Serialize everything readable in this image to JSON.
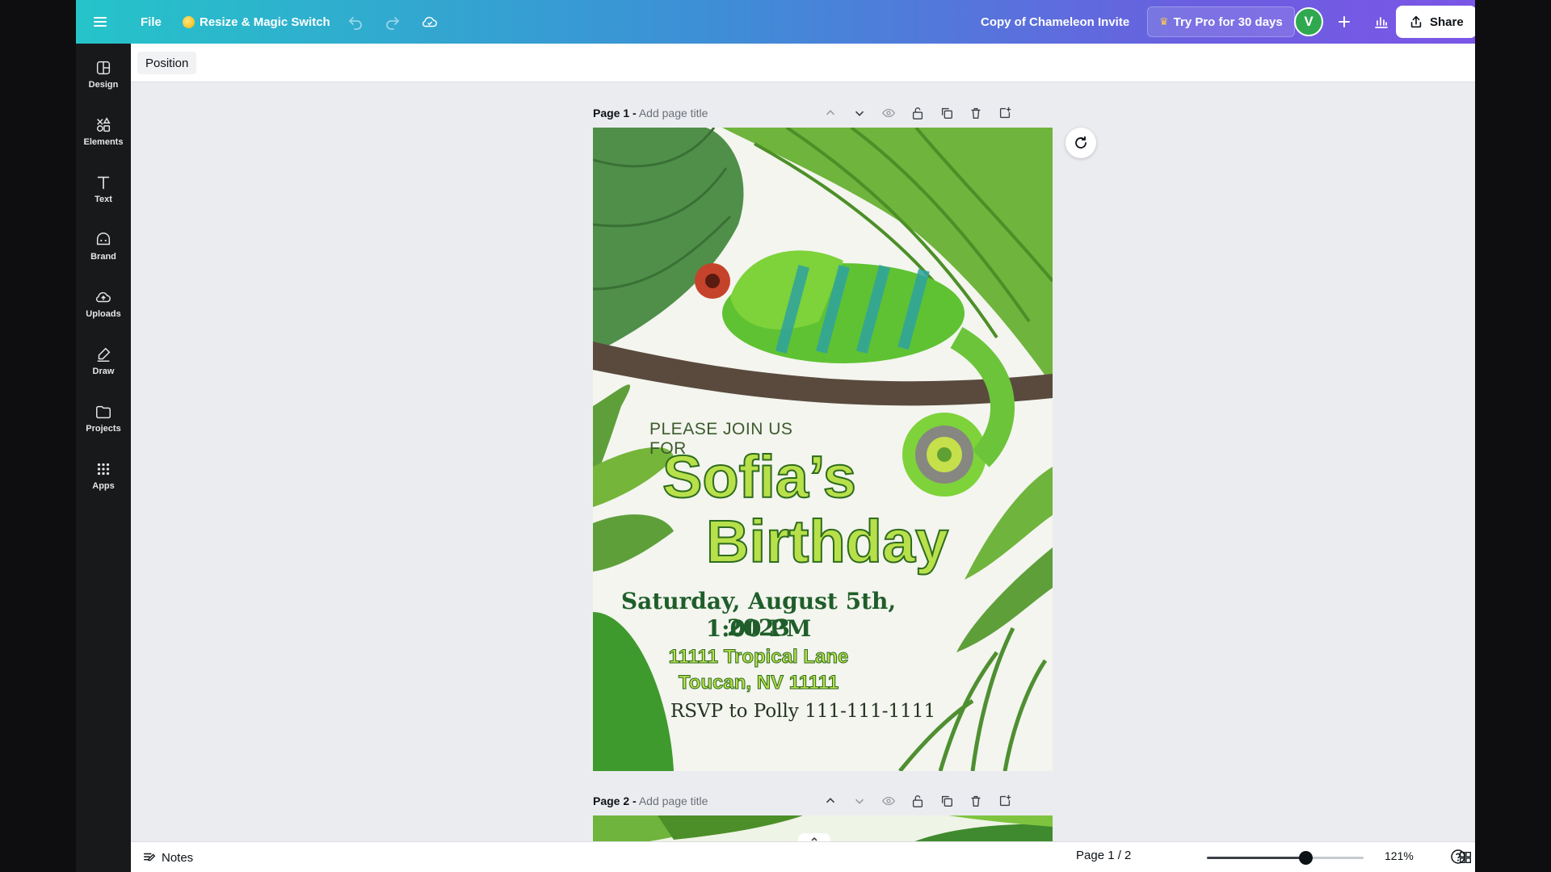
{
  "header": {
    "file_label": "File",
    "magic_label": "Resize & Magic Switch",
    "doc_title": "Copy of Chameleon Invite",
    "pro_label": "Try Pro for 30 days",
    "avatar_initial": "V",
    "share_label": "Share"
  },
  "sidebar": {
    "items": [
      {
        "label": "Design",
        "icon": "layout-icon"
      },
      {
        "label": "Elements",
        "icon": "shapes-icon"
      },
      {
        "label": "Text",
        "icon": "text-icon"
      },
      {
        "label": "Brand",
        "icon": "brand-icon"
      },
      {
        "label": "Uploads",
        "icon": "cloud-upload-icon"
      },
      {
        "label": "Draw",
        "icon": "pen-icon"
      },
      {
        "label": "Projects",
        "icon": "folder-icon"
      },
      {
        "label": "Apps",
        "icon": "grid-icon"
      }
    ]
  },
  "toolbar": {
    "position_label": "Position"
  },
  "pages": [
    {
      "prefix": "Page 1 -",
      "title_placeholder": "Add page title"
    },
    {
      "prefix": "Page 2 -",
      "title_placeholder": "Add page title"
    }
  ],
  "invite": {
    "line_please": "PLEASE JOIN US FOR",
    "line_name": "Sofia’s",
    "line_event": "Birthday",
    "line_date": "Saturday, August 5th, 2023",
    "line_time": "1:00 PM",
    "line_address1": "11111 Tropical Lane",
    "line_address2": "Toucan, NV 11111",
    "line_rsvp": "RSVP to Polly 111-111-1111"
  },
  "footer": {
    "notes_label": "Notes",
    "page_count": "Page 1 / 2",
    "zoom_label": "121%",
    "zoom_fraction": 0.63
  },
  "colors": {
    "header_gradient_start": "#25c4c9",
    "header_gradient_end": "#7b56e6",
    "sidebar_bg": "#18191b",
    "canvas_bg": "#ebecf0"
  }
}
